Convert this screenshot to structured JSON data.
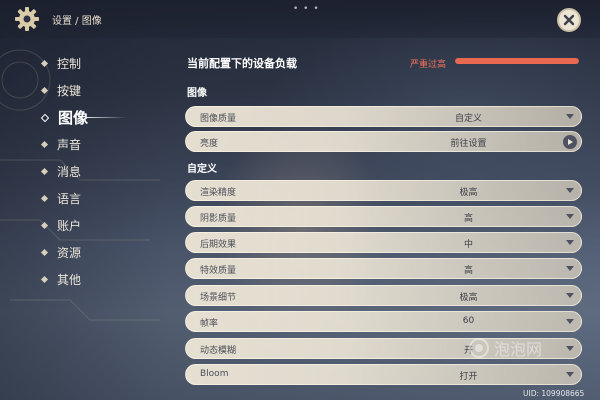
{
  "header": {
    "breadcrumb": "设置 / 图像",
    "drag_handle": "• • •"
  },
  "nav": {
    "items": [
      {
        "label": "控制",
        "active": false
      },
      {
        "label": "按键",
        "active": false
      },
      {
        "label": "图像",
        "active": true
      },
      {
        "label": "声音",
        "active": false
      },
      {
        "label": "消息",
        "active": false
      },
      {
        "label": "语言",
        "active": false
      },
      {
        "label": "账户",
        "active": false
      },
      {
        "label": "资源",
        "active": false
      },
      {
        "label": "其他",
        "active": false
      }
    ]
  },
  "load": {
    "title": "当前配置下的设备负载",
    "status": "严重过高",
    "level_percent": 100,
    "color": "#e8694f"
  },
  "sections": {
    "image_title": "图像",
    "custom_title": "自定义"
  },
  "image_rows": [
    {
      "label": "图像质量",
      "value": "自定义",
      "control": "dropdown"
    },
    {
      "label": "亮度",
      "value": "前往设置",
      "control": "navigate"
    }
  ],
  "custom_rows": [
    {
      "label": "渲染精度",
      "value": "极高"
    },
    {
      "label": "阴影质量",
      "value": "高"
    },
    {
      "label": "后期效果",
      "value": "中"
    },
    {
      "label": "特效质量",
      "value": "高"
    },
    {
      "label": "场景细节",
      "value": "极高"
    },
    {
      "label": "帧率",
      "value": "60"
    },
    {
      "label": "动态模糊",
      "value": "开"
    },
    {
      "label": "Bloom",
      "value": "打开"
    }
  ],
  "footer": {
    "uid": "UID: 109908665",
    "watermark": "泡泡网"
  },
  "icons": {
    "settings": "gear-icon",
    "close": "close-icon",
    "dropdown": "chevron-down-icon",
    "navigate": "play-arrow-icon"
  }
}
